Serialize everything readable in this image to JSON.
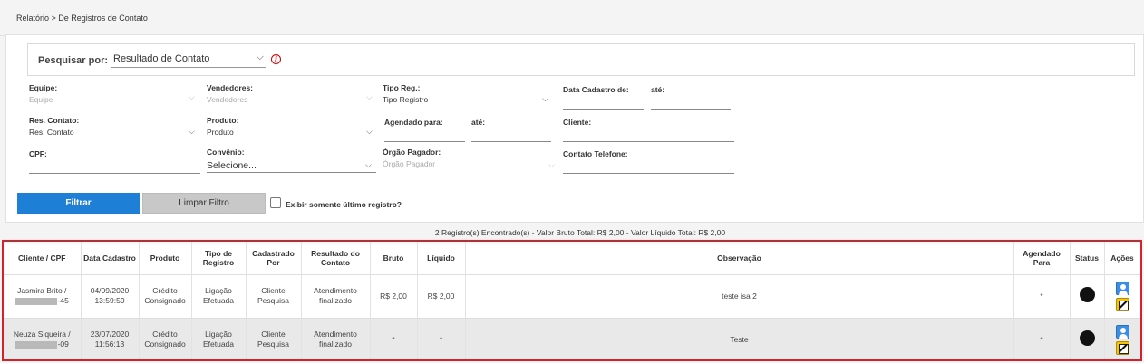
{
  "breadcrumb": "Relatório > De Registros de Contato",
  "search": {
    "label": "Pesquisar por:",
    "selected": "Resultado de Contato"
  },
  "filters": {
    "equipe": {
      "label": "Equipe:",
      "value": "Equipe"
    },
    "vendedores": {
      "label": "Vendedores:",
      "value": "Vendedores"
    },
    "tipo_reg": {
      "label": "Tipo Reg.:",
      "value": "Tipo Registro"
    },
    "data_cadastro": {
      "label": "Data Cadastro de:",
      "ate": "até:"
    },
    "res_contato": {
      "label": "Res. Contato:",
      "value": "Res. Contato"
    },
    "produto": {
      "label": "Produto:",
      "value": "Produto"
    },
    "agendado": {
      "label": "Agendado para:",
      "ate": "até:"
    },
    "cliente": {
      "label": "Cliente:"
    },
    "cpf": {
      "label": "CPF:"
    },
    "convenio": {
      "label": "Convênio:",
      "value": "Selecione..."
    },
    "orgao": {
      "label": "Órgão Pagador:",
      "value": "Órgão Pagador"
    },
    "telefone": {
      "label": "Contato Telefone:"
    }
  },
  "buttons": {
    "filtrar": "Filtrar",
    "limpar": "Limpar Filtro"
  },
  "checkbox_label": "Exibir somente último registro?",
  "summary": "2 Registro(s) Encontrado(s) - Valor Bruto Total: R$ 2,00 - Valor Líquido Total: R$ 2,00",
  "table": {
    "headers": [
      "Cliente / CPF",
      "Data Cadastro",
      "Produto",
      "Tipo de Registro",
      "Cadastrado Por",
      "Resultado do Contato",
      "Bruto",
      "Líquido",
      "Observação",
      "Agendado Para",
      "Status",
      "Ações"
    ],
    "rows": [
      {
        "cliente": "Jasmira Brito /",
        "cpf_suffix": "-45",
        "data": "04/09/2020",
        "hora": "13:59:59",
        "produto1": "Crédito",
        "produto2": "Consignado",
        "tipo1": "Ligação",
        "tipo2": "Efetuada",
        "cad1": "Cliente",
        "cad2": "Pesquisa",
        "res1": "Atendimento",
        "res2": "finalizado",
        "bruto": "R$ 2,00",
        "liquido": "R$ 2,00",
        "obs": "teste isa 2",
        "agendado": "*"
      },
      {
        "cliente": "Neuza Siqueira /",
        "cpf_suffix": "-09",
        "data": "23/07/2020",
        "hora": "11:56:13",
        "produto1": "Crédito",
        "produto2": "Consignado",
        "tipo1": "Ligação",
        "tipo2": "Efetuada",
        "cad1": "Cliente",
        "cad2": "Pesquisa",
        "res1": "Atendimento",
        "res2": "finalizado",
        "bruto": "*",
        "liquido": "*",
        "obs": "Teste",
        "agendado": "*"
      }
    ]
  }
}
